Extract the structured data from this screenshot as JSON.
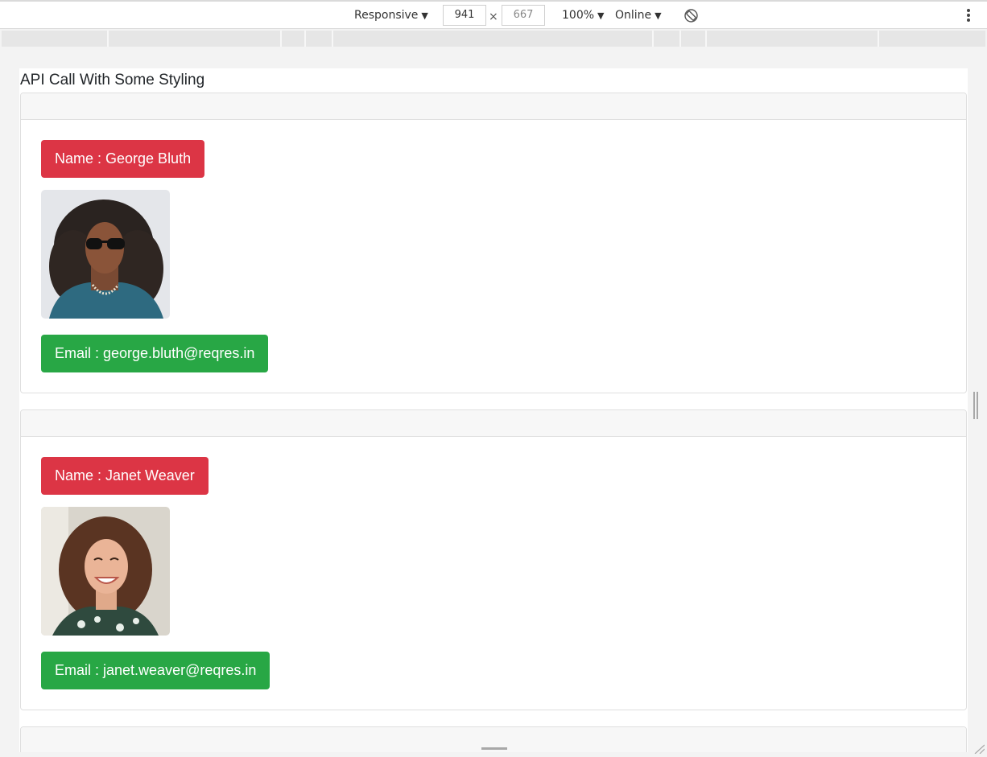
{
  "devtools": {
    "device_mode": "Responsive",
    "width": "941",
    "height": "667",
    "times": "×",
    "zoom": "100%",
    "network": "Online",
    "caret": "▼"
  },
  "page": {
    "heading": "API Call With Some Styling"
  },
  "users": [
    {
      "name_label": "Name : George Bluth",
      "email_label": "Email : george.bluth@reqres.in"
    },
    {
      "name_label": "Name : Janet Weaver",
      "email_label": "Email : janet.weaver@reqres.in"
    }
  ],
  "colors": {
    "name_badge": "#dc3545",
    "email_badge": "#28a745",
    "card_header": "#f7f7f7"
  }
}
